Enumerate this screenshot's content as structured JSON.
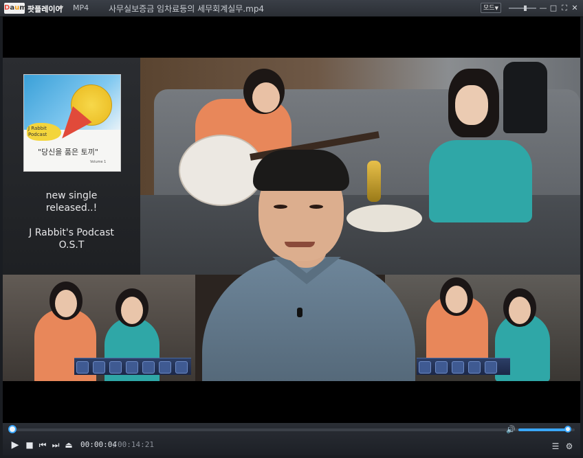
{
  "titlebar": {
    "logo_text": "Daum",
    "app_name": "팟플레이어",
    "format": "MP4",
    "filename": "사무실보증금 임차료등의 세무회계실무.mp4",
    "mode_label": "모드"
  },
  "window_buttons": [
    "minimize-icon",
    "maximize-icon",
    "fullscreen-icon",
    "close-icon"
  ],
  "video": {
    "album": {
      "line1": "J Rabbit",
      "line2": "Podcast",
      "title": "\"당신을 품은 토끼\"",
      "volume": "Volume 1"
    },
    "promo_lines": [
      "new single",
      "released..!",
      "",
      "J Rabbit's Podcast",
      "O.S.T"
    ]
  },
  "playback": {
    "current_time": "00:00:04",
    "separator": "/",
    "total_time": "00:14:21",
    "progress_fraction": 0.005,
    "volume_fraction": 0.97
  },
  "controls": {
    "play": "play-icon",
    "stop": "stop-icon",
    "prev": "prev-icon",
    "next": "next-icon",
    "eject": "eject-icon",
    "playlist": "playlist-icon",
    "settings": "settings-icon",
    "volume": "volume-icon"
  },
  "colors": {
    "accent": "#3aa8ff",
    "titlebar": "#2f3339",
    "background": "#1a1d22"
  }
}
